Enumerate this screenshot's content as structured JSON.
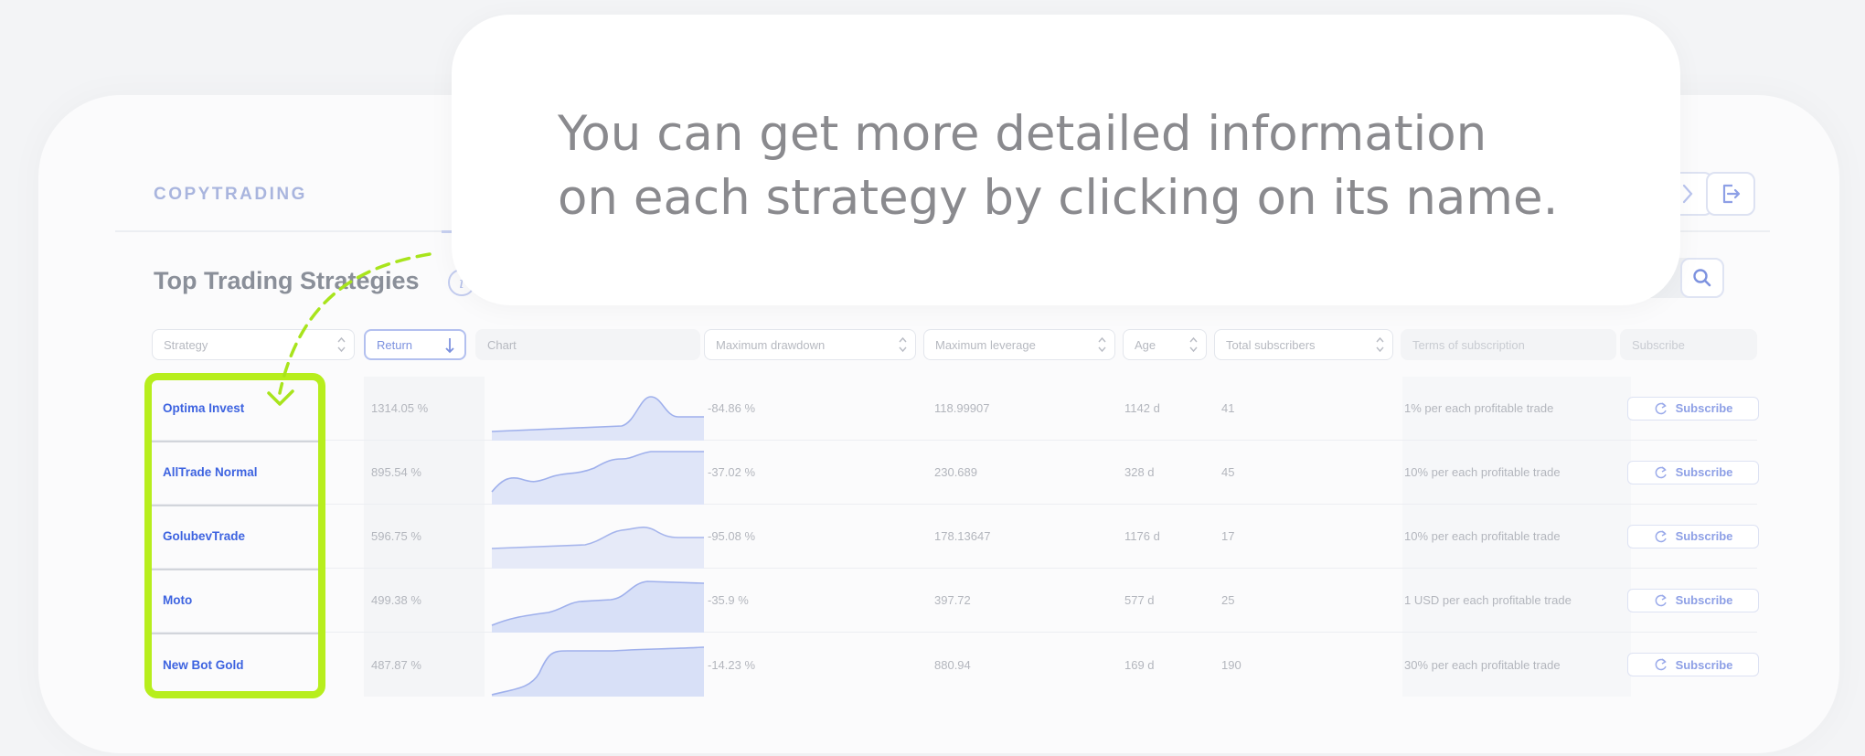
{
  "header": {
    "brand": "COPYTRADING"
  },
  "page": {
    "title": "Top Trading Strategies"
  },
  "tooltip": {
    "line1": "You can get more detailed information",
    "line2": "on each strategy by clicking on its name."
  },
  "search": {
    "placeholder": ""
  },
  "columns": {
    "strategy": "Strategy",
    "return": "Return",
    "chart": "Chart",
    "drawdown": "Maximum drawdown",
    "leverage": "Maximum leverage",
    "age": "Age",
    "subscribers": "Total subscribers",
    "terms": "Terms of subscription",
    "subscribe": "Subscribe"
  },
  "rows": [
    {
      "name": "Optima Invest",
      "return": "1314.05 %",
      "drawdown": "-84.86 %",
      "leverage": "118.99907",
      "age": "1142 d",
      "subscribers": "41",
      "terms": "1% per each profitable trade",
      "button": "Subscribe"
    },
    {
      "name": "AllTrade Normal",
      "return": "895.54 %",
      "drawdown": "-37.02 %",
      "leverage": "230.689",
      "age": "328 d",
      "subscribers": "45",
      "terms": "10% per each profitable trade",
      "button": "Subscribe"
    },
    {
      "name": "GolubevTrade",
      "return": "596.75 %",
      "drawdown": "-95.08 %",
      "leverage": "178.13647",
      "age": "1176 d",
      "subscribers": "17",
      "terms": "10% per each profitable trade",
      "button": "Subscribe"
    },
    {
      "name": "Moto",
      "return": "499.38 %",
      "drawdown": "-35.9 %",
      "leverage": "397.72",
      "age": "577 d",
      "subscribers": "25",
      "terms": "1 USD per each profitable trade",
      "button": "Subscribe"
    },
    {
      "name": "New Bot Gold",
      "return": "487.87 %",
      "drawdown": "-14.23 %",
      "leverage": "880.94",
      "age": "169 d",
      "subscribers": "190",
      "terms": "30% per each profitable trade",
      "button": "Subscribe"
    }
  ],
  "colors": {
    "accent": "#3d63e0",
    "highlight": "#b7ee1d",
    "chart_fill": "#c9d4f6"
  }
}
